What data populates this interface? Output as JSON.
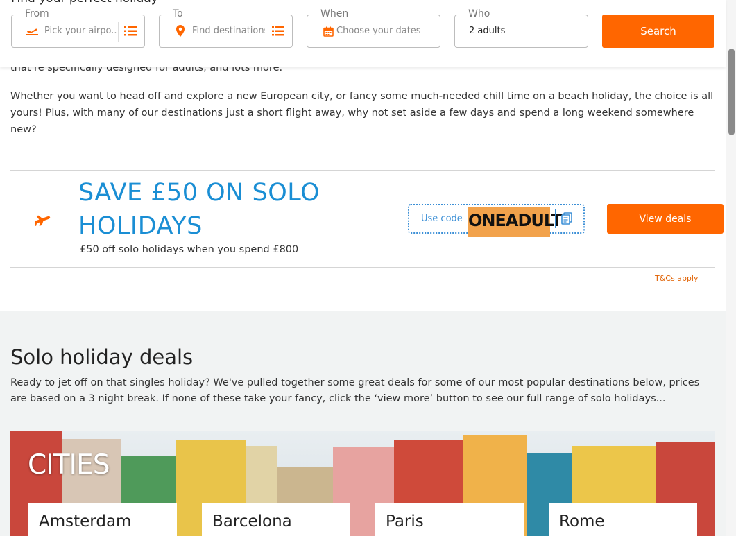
{
  "search": {
    "heading": "Find your perfect holiday",
    "from": {
      "label": "From",
      "placeholder": "Pick your airpo..."
    },
    "to": {
      "label": "To",
      "placeholder": "Find destinations"
    },
    "when": {
      "label": "When",
      "placeholder": "Choose your dates"
    },
    "who": {
      "label": "Who",
      "value": "2 adults"
    },
    "search_label": "Search"
  },
  "intro": {
    "cut_line": "that’re specifically designed for adults, and lots more.",
    "paragraph": "Whether you want to head off and explore a new European city, or fancy some much-needed chill time on a beach holiday, the choice is all yours! Plus, with many of our destinations just a short flight away, why not set aside a few days and spend a long weekend somewhere new?"
  },
  "promo": {
    "title": "SAVE £50 ON SOLO HOLIDAYS",
    "subtitle": "£50 off solo holidays when you spend £800",
    "code_label": "Use code",
    "code": "ONEADULT",
    "cta": "View deals",
    "terms": "T&Cs apply"
  },
  "deals": {
    "title": "Solo holiday deals",
    "description": "Ready to jet off on that singles holiday? We've pulled together some great deals for some of our most popular destinations below, prices are based on a 3 night break. If none of these take your fancy, click the ‘view more’ button to see our full range of solo holidays...",
    "banner_title": "CITIES",
    "cities": [
      "Amsterdam",
      "Barcelona",
      "Paris",
      "Rome"
    ]
  },
  "colors": {
    "accent": "#ff6600",
    "promo_blue": "#1a8ed4",
    "code_highlight": "#f2a24b"
  }
}
